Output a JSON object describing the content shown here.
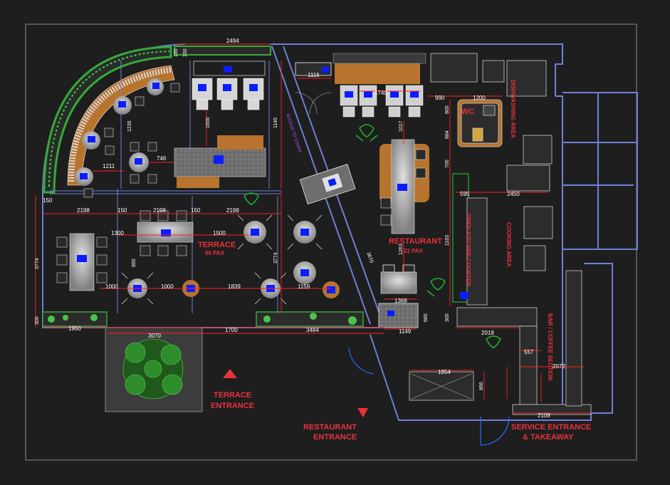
{
  "labels": {
    "terrace": "TERRACE",
    "terrace_pax": "66 PAX",
    "restaurant": "RESTAURANT",
    "restaurant_pax": "22 PAX",
    "wc": "WC",
    "dishwashing": "DISHWASHING AREA",
    "cooking": "COOKING AREA",
    "open_kitchen": "OPEN KITCHEN COUNTER",
    "bar": "BAR / COFFEE SECTION",
    "terrace_entrance_1": "TERRACE",
    "terrace_entrance_2": "ENTRANCE",
    "restaurant_entrance_1": "RESTAURANT",
    "restaurant_entrance_2": "ENTRANCE",
    "service_1": "SERVICE ENTRANCE",
    "service_2": "& TAKEAWAY",
    "access": "ACCESS TO STAIRS"
  },
  "dimensions": {
    "d2494": "2494",
    "d150a": "150",
    "d150b": "150",
    "d2198a": "2198",
    "d2198b": "2198",
    "d2198c": "2198",
    "d150c": "150",
    "d150d": "150",
    "d150e": "150",
    "d3774a": "3774",
    "d3774b": "3774",
    "d1300": "1300",
    "d1500": "1500",
    "d1000a": "1000",
    "d1000b": "1000",
    "d1839": "1839",
    "d1159": "1159",
    "d1950": "1950",
    "d3070": "3070",
    "d1700": "1700",
    "d3484": "3484",
    "d300": "300",
    "d746": "746",
    "d1211": "1211",
    "d1235": "1235",
    "d1145": "1145",
    "d1500v": "1500",
    "d1116": "1116",
    "d1740": "1740",
    "d990": "990",
    "d1200": "1200",
    "d800": "800",
    "d884": "884",
    "d700": "700",
    "d595": "595",
    "d2450": "2450",
    "d1163": "1163",
    "d1017": "1017",
    "d1263": "1263",
    "d1368": "1368",
    "d1149": "1149",
    "d2018": "2018",
    "d557": "557",
    "d2072": "2072",
    "d1954": "1954",
    "d866": "866",
    "d2108": "2108",
    "d3670": "3670",
    "d850": "850",
    "d300b": "300",
    "d660": "660"
  },
  "colors": {
    "background": "#1e1e1e",
    "wall": "#6f7fd6",
    "label_red": "#e8323c",
    "dim_line": "#ff2020",
    "table_blue": "#0b1dff",
    "furniture_brown": "#b8732e",
    "planter_green": "#35a83a",
    "kitchen_green": "#1fb52b"
  }
}
